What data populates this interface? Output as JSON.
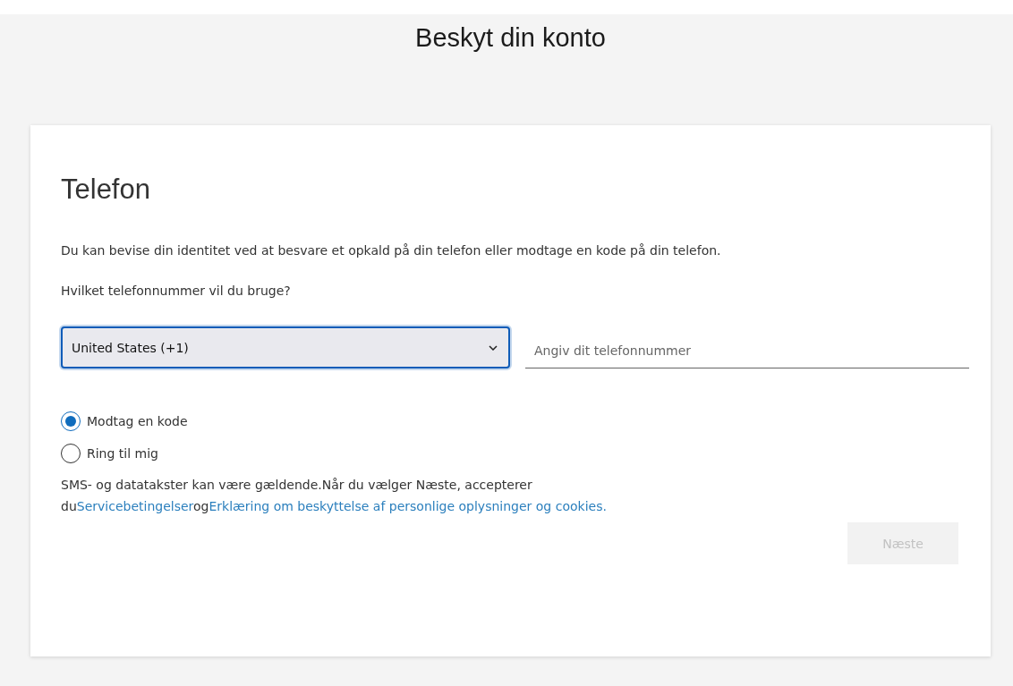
{
  "page_title": "Beskyt din konto",
  "card": {
    "heading": "Telefon",
    "description": "Du kan bevise din identitet ved at besvare et opkald på din telefon eller modtage en kode på din telefon.",
    "question": "Hvilket telefonnummer vil du bruge?",
    "country_select": {
      "value": "United States (+1)",
      "focused": true
    },
    "phone_field": {
      "placeholder": "Angiv dit telefonnummer"
    },
    "options": [
      {
        "label": "Modtag en kode",
        "selected": true
      },
      {
        "label": "Ring til mig",
        "selected": false
      }
    ],
    "legal": [
      {
        "kind": "text",
        "text": "SMS- og datatakster kan være gældende.Når du vælger Næste, accepterer du"
      },
      {
        "kind": "link",
        "text": "Servicebetingelser"
      },
      {
        "kind": "text",
        "text": "og"
      },
      {
        "kind": "link",
        "text": "Erklæring om beskyttelse af personlige oplysninger og cookies."
      }
    ],
    "next_button": {
      "label": "Næste",
      "disabled": true
    }
  }
}
